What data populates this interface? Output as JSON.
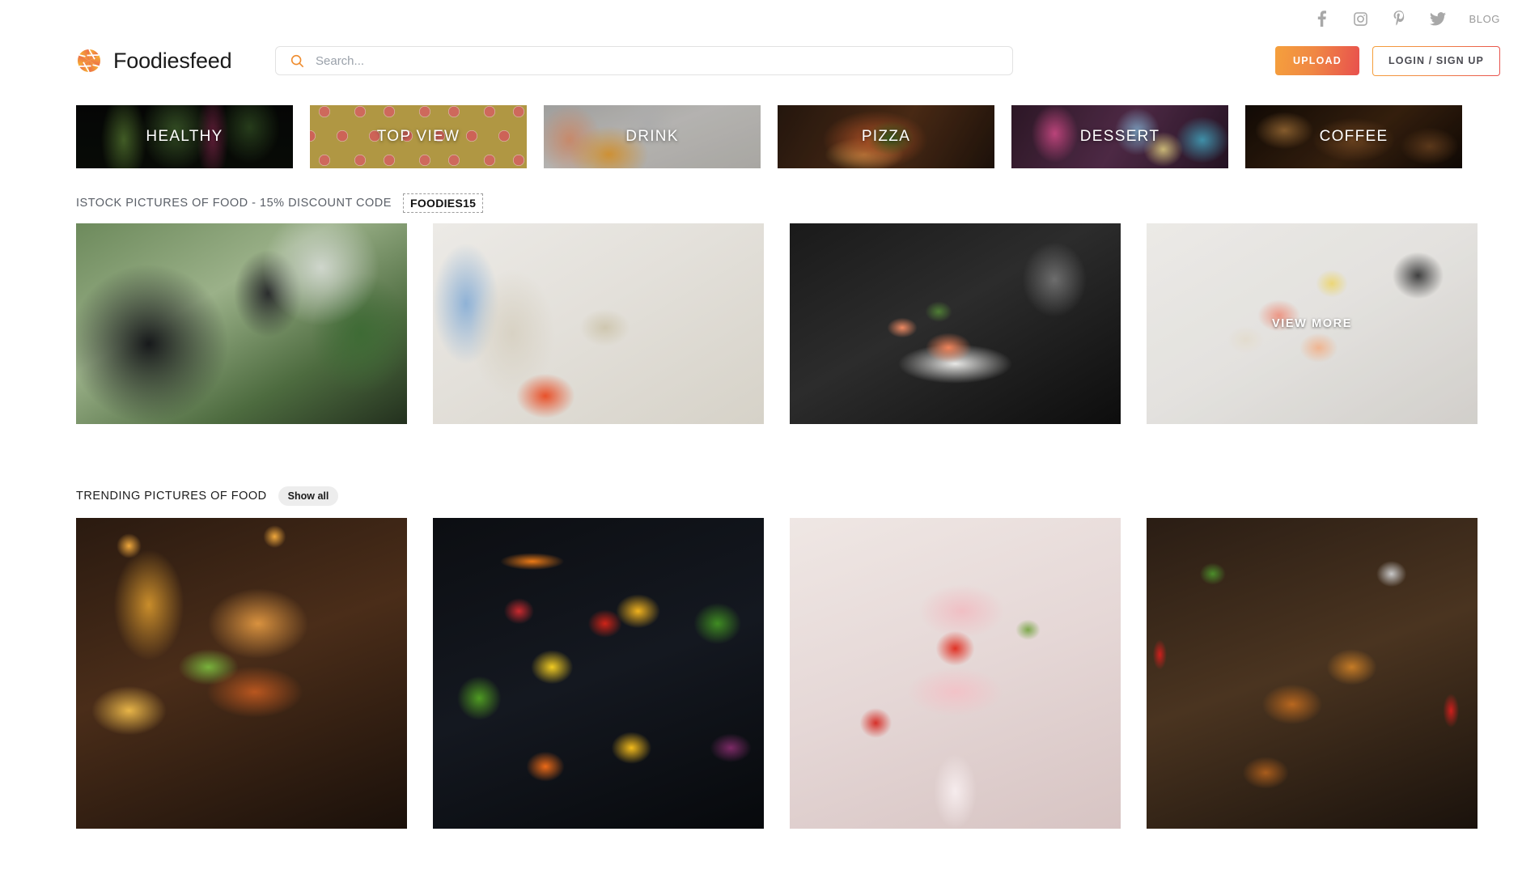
{
  "topbar": {
    "social": [
      {
        "name": "facebook-icon",
        "label": "Facebook"
      },
      {
        "name": "instagram-icon",
        "label": "Instagram"
      },
      {
        "name": "pinterest-icon",
        "label": "Pinterest"
      },
      {
        "name": "twitter-icon",
        "label": "Twitter"
      }
    ],
    "blog_label": "BLOG"
  },
  "header": {
    "brand_name": "Foodiesfeed",
    "search": {
      "value": "",
      "placeholder": "Search..."
    },
    "upload_label": "UPLOAD",
    "login_label": "LOGIN / SIGN UP"
  },
  "categories": [
    {
      "label": "HEALTHY",
      "bg": "bg-healthy"
    },
    {
      "label": "TOP VIEW",
      "bg": "bg-topview"
    },
    {
      "label": "DRINK",
      "bg": "bg-drink"
    },
    {
      "label": "PIZZA",
      "bg": "bg-pizza"
    },
    {
      "label": "DESSERT",
      "bg": "bg-dessert"
    },
    {
      "label": "COFFEE",
      "bg": "bg-coffee"
    }
  ],
  "istock_section": {
    "title": "ISTOCK PICTURES OF FOOD - 15% DISCOUNT CODE",
    "code": "FOODIES15",
    "view_more_label": "VIEW MORE",
    "items": [
      {
        "alt": "food-delivery-cyclist-with-backpack",
        "bg": "ph-cyclist"
      },
      {
        "alt": "woman-cooking-in-kitchen-with-orange-pot",
        "bg": "ph-cooking"
      },
      {
        "alt": "salmon-appetizer-on-white-plate",
        "bg": "ph-salmon"
      },
      {
        "alt": "sashimi-bowl-with-chopsticks",
        "bg": "ph-sashimi"
      }
    ]
  },
  "trending_section": {
    "title": "TRENDING PICTURES OF FOOD",
    "show_all_label": "Show all",
    "items": [
      {
        "alt": "cheeseburger-with-fries-and-beer",
        "bg": "ph-burger"
      },
      {
        "alt": "assorted-fresh-vegetables-flat-lay",
        "bg": "ph-veggies"
      },
      {
        "alt": "strawberry-milkshake-splash",
        "bg": "ph-strawberry"
      },
      {
        "alt": "glazed-sesame-chicken-wings",
        "bg": "ph-wings"
      }
    ]
  },
  "colors": {
    "accent_orange": "#ef8c2e",
    "accent_red": "#e8504d",
    "text_dark": "#1a1a1a",
    "text_muted": "#9a9a9a"
  }
}
